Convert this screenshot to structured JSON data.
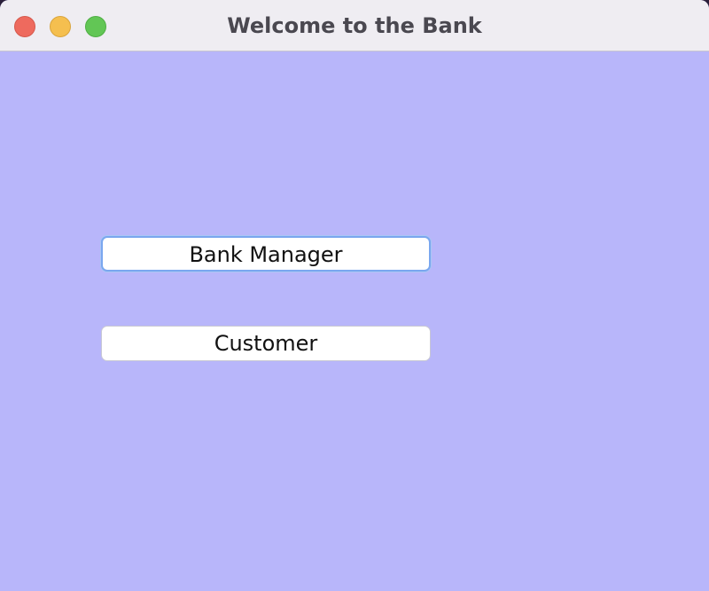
{
  "window": {
    "title": "Welcome to the Bank"
  },
  "buttons": {
    "bank_manager_label": "Bank Manager",
    "customer_label": "Customer"
  },
  "colors": {
    "content_background": "#b8b6fa",
    "titlebar_background": "#efedf2",
    "focus_ring": "#7aa7ef",
    "close": "#ee6a5e",
    "minimize": "#f5bf4f",
    "zoom": "#62c655"
  }
}
